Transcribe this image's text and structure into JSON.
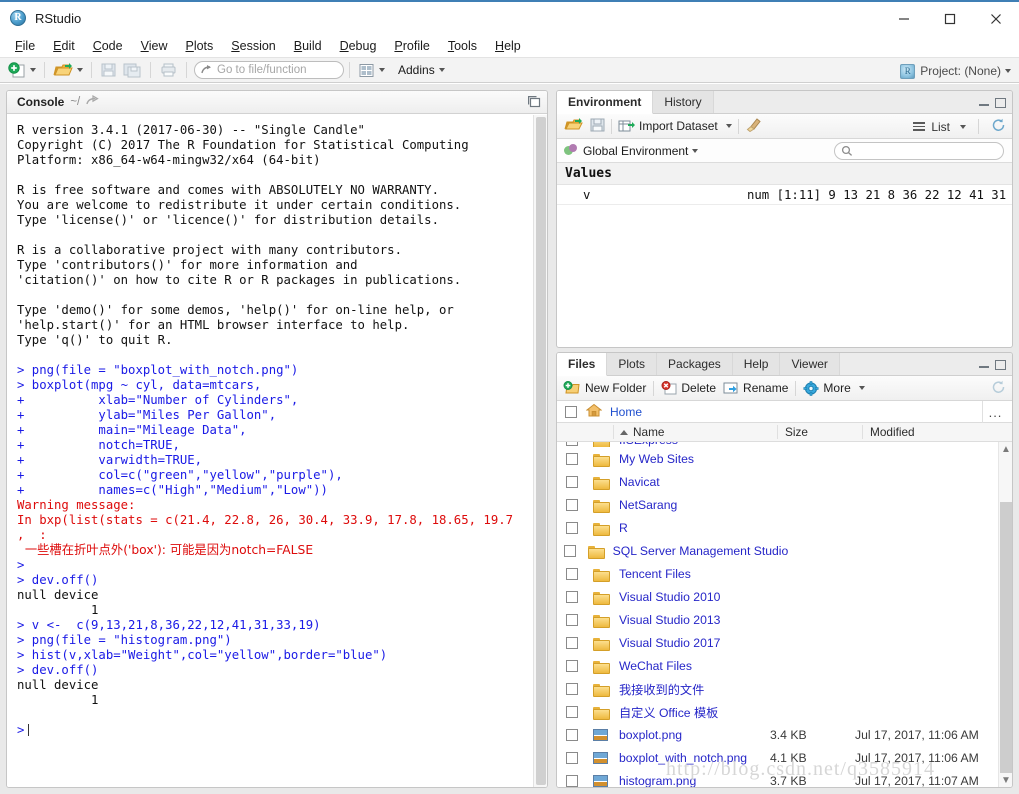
{
  "window": {
    "title": "RStudio",
    "logo_icon": "r-logo-icon",
    "minimize_label": "Minimize",
    "maximize_label": "Maximize",
    "close_label": "Close"
  },
  "menubar": {
    "items": [
      {
        "label": "File",
        "mnemonic": "F"
      },
      {
        "label": "Edit",
        "mnemonic": "E"
      },
      {
        "label": "Code",
        "mnemonic": "C"
      },
      {
        "label": "View",
        "mnemonic": "V"
      },
      {
        "label": "Plots",
        "mnemonic": "P"
      },
      {
        "label": "Session",
        "mnemonic": "S"
      },
      {
        "label": "Build",
        "mnemonic": "B"
      },
      {
        "label": "Debug",
        "mnemonic": "D"
      },
      {
        "label": "Profile",
        "mnemonic": "P"
      },
      {
        "label": "Tools",
        "mnemonic": "T"
      },
      {
        "label": "Help",
        "mnemonic": "H"
      }
    ]
  },
  "toolbar": {
    "new_file_icon": "new-file-icon",
    "open_file_icon": "open-folder-icon",
    "save_icon": "save-icon",
    "save_all_icon": "save-all-icon",
    "print_icon": "print-icon",
    "goto_placeholder": "Go to file/function",
    "goto_icon": "goto-arrow-icon",
    "panes_icon": "pane-layout-icon",
    "addins_label": "Addins",
    "project_label": "Project: (None)",
    "project_icon": "project-icon"
  },
  "console": {
    "tab_label": "Console",
    "path": "~/",
    "popout_icon": "popout-icon",
    "maximize_icon": "maximize-pane-icon",
    "lines": [
      {
        "t": "R version 3.4.1 (2017-06-30) -- \"Single Candle\"",
        "c": "plain"
      },
      {
        "t": "Copyright (C) 2017 The R Foundation for Statistical Computing",
        "c": "plain"
      },
      {
        "t": "Platform: x86_64-w64-mingw32/x64 (64-bit)",
        "c": "plain"
      },
      {
        "t": "",
        "c": "plain"
      },
      {
        "t": "R is free software and comes with ABSOLUTELY NO WARRANTY.",
        "c": "plain"
      },
      {
        "t": "You are welcome to redistribute it under certain conditions.",
        "c": "plain"
      },
      {
        "t": "Type 'license()' or 'licence()' for distribution details.",
        "c": "plain"
      },
      {
        "t": "",
        "c": "plain"
      },
      {
        "t": "R is a collaborative project with many contributors.",
        "c": "plain"
      },
      {
        "t": "Type 'contributors()' for more information and",
        "c": "plain"
      },
      {
        "t": "'citation()' on how to cite R or R packages in publications.",
        "c": "plain"
      },
      {
        "t": "",
        "c": "plain"
      },
      {
        "t": "Type 'demo()' for some demos, 'help()' for on-line help, or",
        "c": "plain"
      },
      {
        "t": "'help.start()' for an HTML browser interface to help.",
        "c": "plain"
      },
      {
        "t": "Type 'q()' to quit R.",
        "c": "plain"
      },
      {
        "t": "",
        "c": "plain"
      },
      {
        "t": "> png(file = \"boxplot_with_notch.png\")",
        "c": "blue"
      },
      {
        "t": "> boxplot(mpg ~ cyl, data=mtcars,",
        "c": "blue"
      },
      {
        "t": "+          xlab=\"Number of Cylinders\",",
        "c": "blue"
      },
      {
        "t": "+          ylab=\"Miles Per Gallon\",",
        "c": "blue"
      },
      {
        "t": "+          main=\"Mileage Data\",",
        "c": "blue"
      },
      {
        "t": "+          notch=TRUE,",
        "c": "blue"
      },
      {
        "t": "+          varwidth=TRUE,",
        "c": "blue"
      },
      {
        "t": "+          col=c(\"green\",\"yellow\",\"purple\"),",
        "c": "blue"
      },
      {
        "t": "+          names=c(\"High\",\"Medium\",\"Low\"))",
        "c": "blue"
      },
      {
        "t": "Warning message:",
        "c": "red"
      },
      {
        "t": "In bxp(list(stats = c(21.4, 22.8, 26, 30.4, 33.9, 17.8, 18.65, 19.7",
        "c": "red"
      },
      {
        "t": ",  :",
        "c": "red"
      },
      {
        "t": "  一些槽在折叶点外('box'): 可能是因为notch=FALSE",
        "c": "red-cn"
      },
      {
        "t": ">",
        "c": "blue"
      },
      {
        "t": "> dev.off()",
        "c": "blue"
      },
      {
        "t": "null device",
        "c": "plain"
      },
      {
        "t": "          1",
        "c": "plain"
      },
      {
        "t": "> v <-  c(9,13,21,8,36,22,12,41,31,33,19)",
        "c": "blue"
      },
      {
        "t": "> png(file = \"histogram.png\")",
        "c": "blue"
      },
      {
        "t": "> hist(v,xlab=\"Weight\",col=\"yellow\",border=\"blue\")",
        "c": "blue"
      },
      {
        "t": "> dev.off()",
        "c": "blue"
      },
      {
        "t": "null device",
        "c": "plain"
      },
      {
        "t": "          1",
        "c": "plain"
      },
      {
        "t": "",
        "c": "plain"
      },
      {
        "t": ">",
        "c": "blue"
      }
    ]
  },
  "environment": {
    "tabs": [
      {
        "label": "Environment",
        "active": true
      },
      {
        "label": "History",
        "active": false
      }
    ],
    "toolbar": {
      "open_icon": "open-workspace-icon",
      "save_icon": "save-workspace-icon",
      "import_label": "Import Dataset",
      "import_icon": "import-dataset-icon",
      "broom_icon": "clear-objects-broom-icon",
      "view_label": "List",
      "view_icon": "list-view-icon",
      "refresh_icon": "refresh-icon"
    },
    "scope_label": "Global Environment",
    "scope_icon": "global-environment-icon",
    "search_placeholder": "",
    "search_icon": "search-icon",
    "section_label": "Values",
    "rows": [
      {
        "name": "v",
        "value": "num [1:11] 9 13 21 8 36 22 12 41 31 …"
      }
    ]
  },
  "files": {
    "tabs": [
      {
        "label": "Files",
        "active": true
      },
      {
        "label": "Plots",
        "active": false
      },
      {
        "label": "Packages",
        "active": false
      },
      {
        "label": "Help",
        "active": false
      },
      {
        "label": "Viewer",
        "active": false
      }
    ],
    "toolbar": {
      "new_folder_label": "New Folder",
      "new_folder_icon": "new-folder-icon",
      "delete_label": "Delete",
      "delete_icon": "delete-icon",
      "rename_label": "Rename",
      "rename_icon": "rename-icon",
      "more_label": "More",
      "more_icon": "gear-icon",
      "refresh_icon": "refresh-icon"
    },
    "path": {
      "home_label": "Home",
      "home_icon": "home-icon",
      "select_all_icon": "select-all-checkbox",
      "overflow_label": "..."
    },
    "columns": {
      "name": "Name",
      "size": "Size",
      "modified": "Modified",
      "sort_icon": "sort-ascending-icon"
    },
    "rows": [
      {
        "name": "IISExpress",
        "type": "folder",
        "size": "",
        "modified": "",
        "clipped": true
      },
      {
        "name": "My Web Sites",
        "type": "folder",
        "size": "",
        "modified": ""
      },
      {
        "name": "Navicat",
        "type": "folder",
        "size": "",
        "modified": ""
      },
      {
        "name": "NetSarang",
        "type": "folder",
        "size": "",
        "modified": ""
      },
      {
        "name": "R",
        "type": "folder",
        "size": "",
        "modified": ""
      },
      {
        "name": "SQL Server Management Studio",
        "type": "folder",
        "size": "",
        "modified": ""
      },
      {
        "name": "Tencent Files",
        "type": "folder",
        "size": "",
        "modified": ""
      },
      {
        "name": "Visual Studio 2010",
        "type": "folder",
        "size": "",
        "modified": ""
      },
      {
        "name": "Visual Studio 2013",
        "type": "folder",
        "size": "",
        "modified": ""
      },
      {
        "name": "Visual Studio 2017",
        "type": "folder",
        "size": "",
        "modified": ""
      },
      {
        "name": "WeChat Files",
        "type": "folder",
        "size": "",
        "modified": ""
      },
      {
        "name": "我接收到的文件",
        "type": "folder",
        "size": "",
        "modified": ""
      },
      {
        "name": "自定义 Office 模板",
        "type": "folder",
        "size": "",
        "modified": ""
      },
      {
        "name": "boxplot.png",
        "type": "image",
        "size": "3.4 KB",
        "modified": "Jul 17, 2017, 11:06 AM"
      },
      {
        "name": "boxplot_with_notch.png",
        "type": "image",
        "size": "4.1 KB",
        "modified": "Jul 17, 2017, 11:06 AM"
      },
      {
        "name": "histogram.png",
        "type": "image",
        "size": "3.7 KB",
        "modified": "Jul 17, 2017, 11:07 AM"
      }
    ]
  },
  "watermark": {
    "text": "http://blog.csdn.net/q3585914"
  },
  "colors": {
    "accent": "#3f7fb5",
    "console_prompt": "#1a1ae6",
    "console_error": "#dd0b0b",
    "link": "#2626c8"
  }
}
